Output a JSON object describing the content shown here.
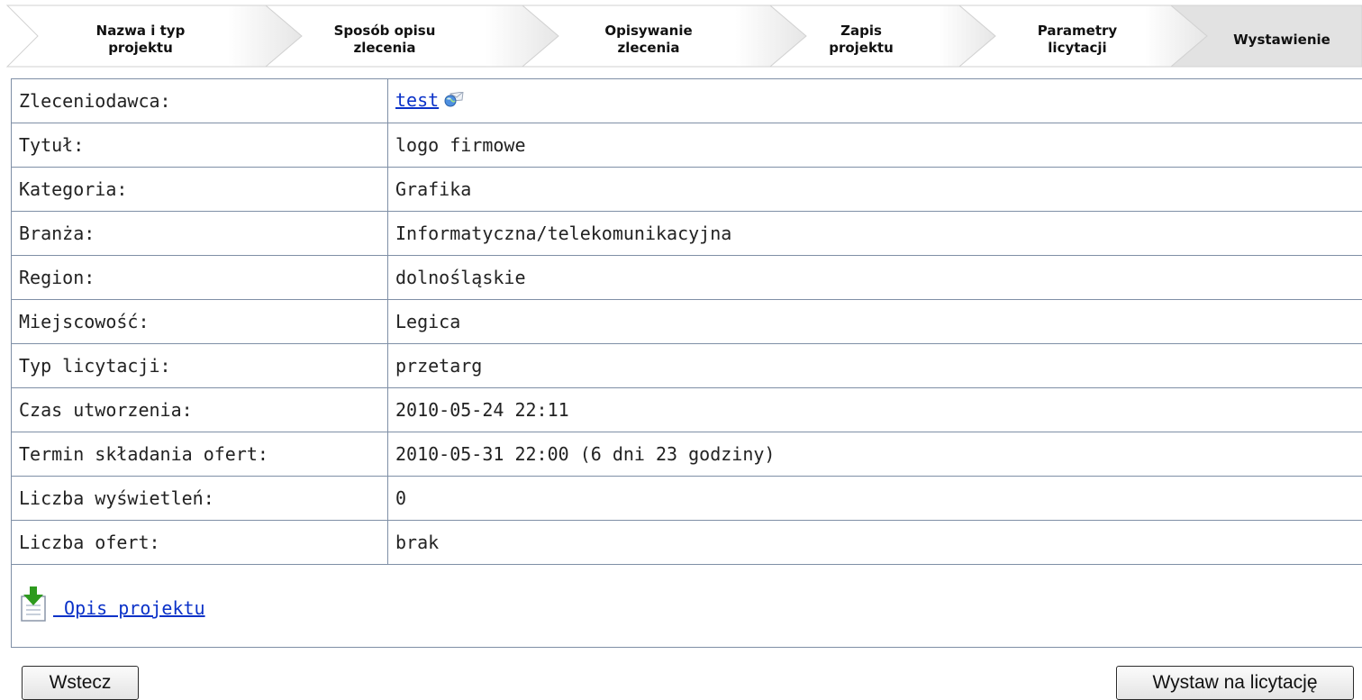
{
  "wizard": {
    "steps": [
      {
        "label": "Nazwa i typ\nprojektu"
      },
      {
        "label": "Sposób opisu\nzlecenia"
      },
      {
        "label": "Opisywanie\nzlecenia"
      },
      {
        "label": "Zapis\nprojektu"
      },
      {
        "label": "Parametry\nlicytacji"
      },
      {
        "label": "Wystawienie"
      }
    ],
    "active_step": 6
  },
  "details": {
    "zleceniodawca": {
      "label": "Zleceniodawca:",
      "value": "test",
      "icon": "globe-message-icon"
    },
    "tytul": {
      "label": "Tytuł:",
      "value": "logo firmowe"
    },
    "kategoria": {
      "label": "Kategoria:",
      "value": "Grafika"
    },
    "branza": {
      "label": "Branża:",
      "value": "Informatyczna/telekomunikacyjna"
    },
    "region": {
      "label": "Region:",
      "value": "dolnośląskie"
    },
    "miejscowosc": {
      "label": "Miejscowość:",
      "value": "Legica"
    },
    "typ_licytacji": {
      "label": "Typ licytacji:",
      "value": "przetarg"
    },
    "czas_utworzenia": {
      "label": "Czas utworzenia:",
      "value": "2010-05-24 22:11"
    },
    "termin": {
      "label": "Termin składania ofert:",
      "value": "2010-05-31 22:00 (6 dni 23 godziny)"
    },
    "wyswietlenia": {
      "label": "Liczba wyświetleń:",
      "value": "0"
    },
    "oferty": {
      "label": "Liczba ofert:",
      "value": "brak"
    }
  },
  "opis": {
    "link": " Opis projektu",
    "icon": "download-document-icon"
  },
  "buttons": {
    "back": "Wstecz",
    "publish": "Wystaw na licytację"
  },
  "colors": {
    "link": "#0b32c8",
    "border": "#7f8fa6",
    "arrow_green": "#2e9a1e",
    "active_step_bg": "#e2e2e2"
  }
}
